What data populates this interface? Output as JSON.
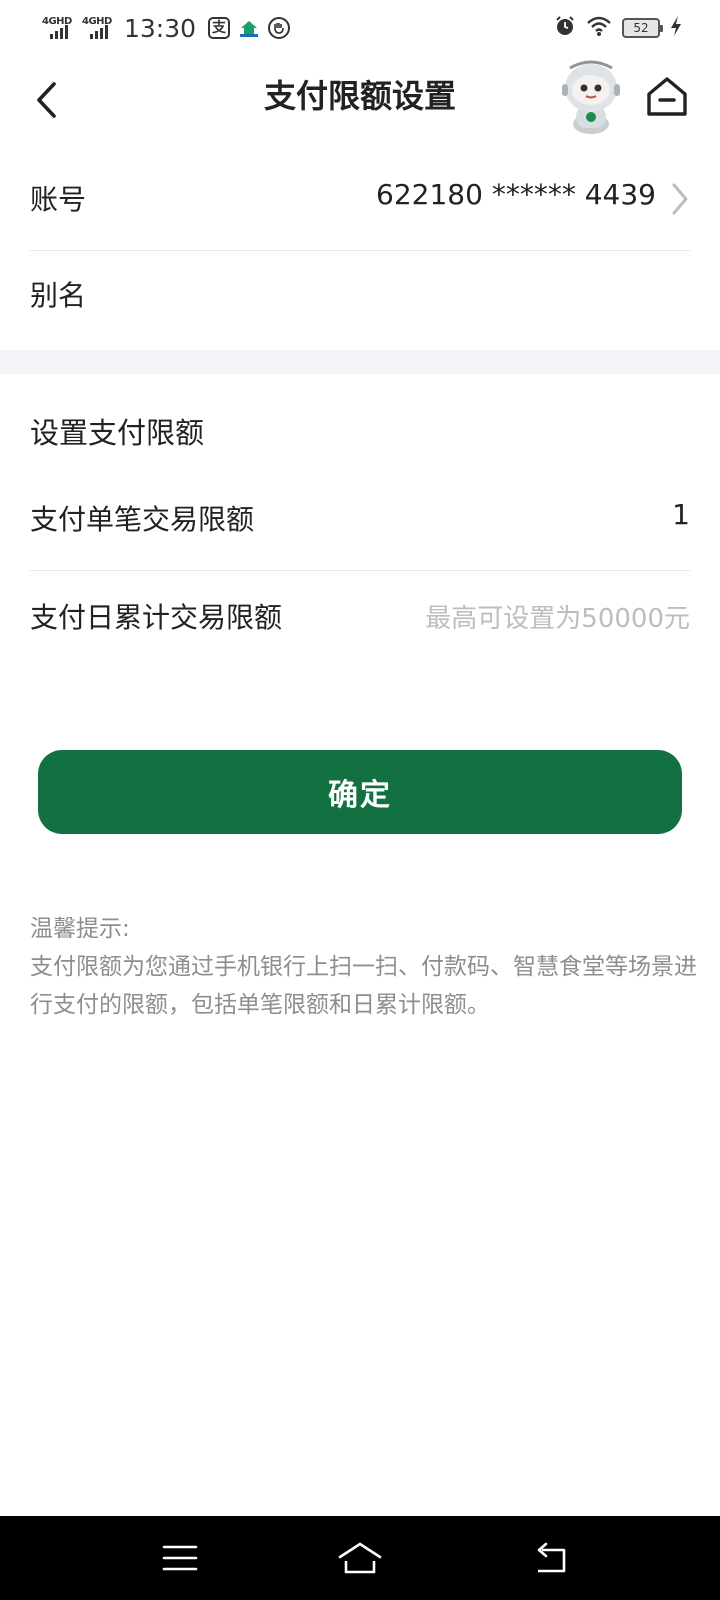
{
  "status_bar": {
    "network_1": "4GHD",
    "network_2": "4GHD",
    "time": "13:30",
    "app_icon_1": "支",
    "battery": "52",
    "icons": [
      "alarm-icon",
      "wifi-icon",
      "battery-icon",
      "charging-icon"
    ]
  },
  "header": {
    "title": "支付限额设置",
    "back_icon": "chevron-left-icon",
    "mascot": "robot-mascot",
    "home_icon": "home-icon"
  },
  "account": {
    "label": "账号",
    "value": "622180 ****** 4439",
    "chevron": "chevron-right-icon"
  },
  "alias": {
    "label": "别名",
    "value": ""
  },
  "limits": {
    "section_title": "设置支付限额",
    "single_label": "支付单笔交易限额",
    "single_value": "1",
    "daily_label": "支付日累计交易限额",
    "daily_placeholder": "最高可设置为50000元"
  },
  "confirm_button": "确定",
  "tips": {
    "title": "温馨提示:",
    "body": "支付限额为您通过手机银行上扫一扫、付款码、智慧食堂等场景进行支付的限额，包括单笔限额和日累计限额。"
  },
  "colors": {
    "primary": "#127041",
    "placeholder": "#bdbdbd",
    "tips": "#8e8e8e",
    "band": "#f4f4f8"
  },
  "nav_bar": {
    "icons": [
      "menu-icon",
      "home-nav-icon",
      "back-nav-icon"
    ]
  }
}
